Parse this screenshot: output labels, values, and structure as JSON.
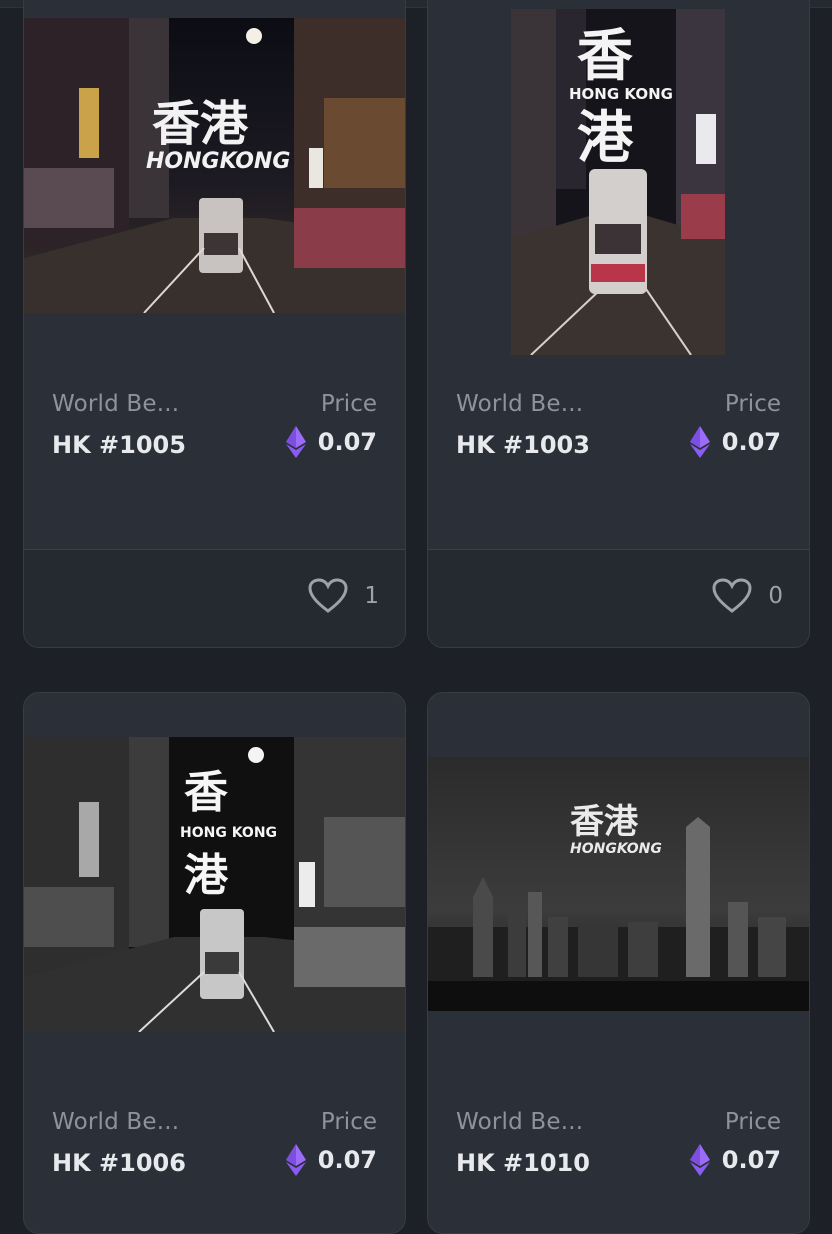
{
  "colors": {
    "background": "#1d2127",
    "card": "#2b2f37",
    "footer": "#252930",
    "eth_purple": "#8a5cf6",
    "muted_text": "#8d939c",
    "bright_text": "#e7e9ec"
  },
  "cards": [
    {
      "collection": "World Be...",
      "title": "HK #1005",
      "price_label": "Price",
      "price": "0.07",
      "likes": "1",
      "image": {
        "text_cn": "香港",
        "text_en": "HONGKONG"
      }
    },
    {
      "collection": "World Be...",
      "title": "HK #1003",
      "price_label": "Price",
      "price": "0.07",
      "likes": "0",
      "image": {
        "text_cn_top": "香",
        "text_cn_bottom": "港",
        "text_en": "HONG KONG"
      }
    },
    {
      "collection": "World Be...",
      "title": "HK #1006",
      "price_label": "Price",
      "price": "0.07",
      "image": {
        "text_cn_top": "香",
        "text_cn_bottom": "港",
        "text_en": "HONG KONG"
      }
    },
    {
      "collection": "World Be...",
      "title": "HK #1010",
      "price_label": "Price",
      "price": "0.07",
      "image": {
        "text_cn": "香港",
        "text_en": "HONGKONG"
      }
    }
  ],
  "icons": {
    "currency": "ethereum-icon",
    "like": "heart-icon"
  }
}
